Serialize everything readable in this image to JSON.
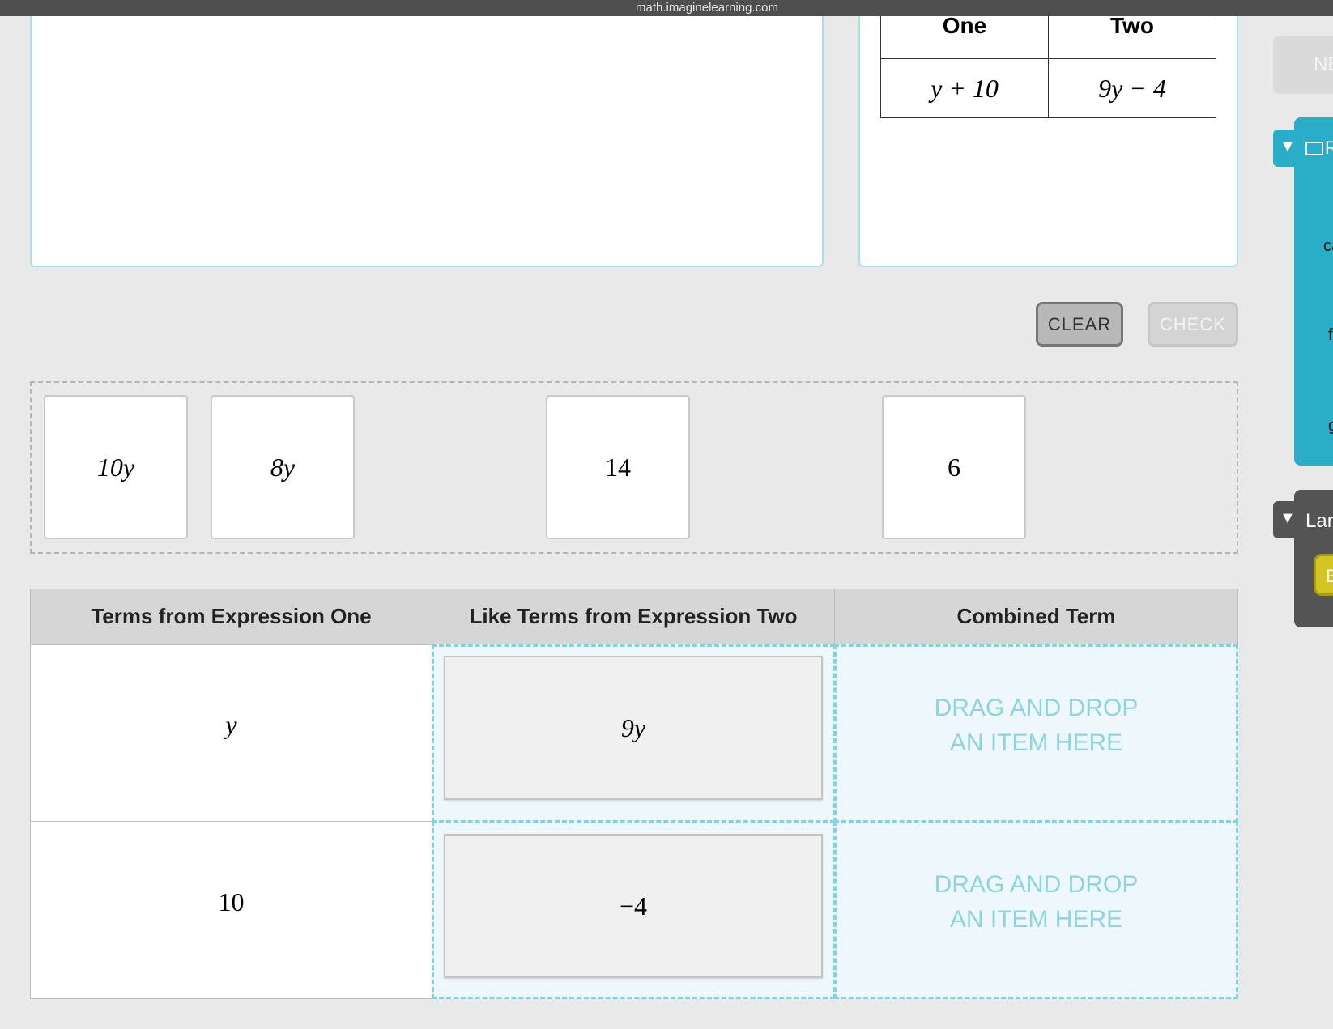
{
  "browser": {
    "url": "math.imaginelearning.com"
  },
  "expressions": {
    "headers": [
      "One",
      "Two"
    ],
    "values": [
      "y + 10",
      "9y − 4"
    ]
  },
  "buttons": {
    "clear": "CLEAR",
    "check": "CHECK",
    "next": "NE"
  },
  "bank": {
    "tiles": [
      "10y",
      "8y",
      "14",
      "6"
    ]
  },
  "table": {
    "headers": [
      "Terms from Expression One",
      "Like Terms from Expression Two",
      "Combined Term"
    ],
    "rows": [
      {
        "term": "y",
        "like": "9y",
        "combined_placeholder": "DRAG AND DROP AN ITEM HERE"
      },
      {
        "term": "10",
        "like": "−4",
        "combined_placeholder": "DRAG AND DROP AN ITEM HERE"
      }
    ]
  },
  "side": {
    "teal_tab": "R",
    "teal_lines": [
      "ca",
      "f",
      "g"
    ],
    "dark_tab": "Lar",
    "yellow_button": "E"
  },
  "colors": {
    "accent": "#2aaec7",
    "drop_border": "#7fd3e3",
    "dark": "#545454",
    "yellow": "#d4c520"
  }
}
